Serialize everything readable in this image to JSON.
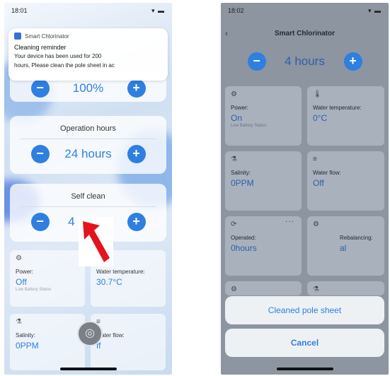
{
  "left_screen": {
    "status_time": "18:01",
    "status_icons": "▾ ▬",
    "notification": {
      "app_name": "Smart Chlorinator",
      "title": "Cleaning reminder",
      "body_line1": "Your device has been used for 200",
      "body_line2": "hours, Please clean the pole sheet in ac"
    },
    "stepper_top": {
      "minus": "−",
      "value": "100%",
      "plus": "+"
    },
    "operation_hours": {
      "title": "Operation hours",
      "minus": "−",
      "value": "24 hours",
      "plus": "+"
    },
    "self_clean": {
      "title": "Self clean",
      "minus": "−",
      "value": "4 hours",
      "plus": "+"
    },
    "tiles": [
      {
        "icon": "⚙",
        "label": "Power:",
        "value": "Off",
        "sub": "Low Battery Status"
      },
      {
        "icon": "🌡",
        "label": "Water temperature:",
        "value": "30.7°C",
        "sub": ""
      },
      {
        "icon": "⚗",
        "label": "Salinity:",
        "value": "0PPM",
        "sub": ""
      },
      {
        "icon": "≡",
        "label": "Water flow:",
        "value": "ff",
        "sub": ""
      }
    ],
    "fab_icon": "◎"
  },
  "right_screen": {
    "status_time": "18:02",
    "status_icons": "▾ ▬",
    "nav": {
      "back": "‹",
      "title": "Smart Chlorinator"
    },
    "stepper": {
      "minus": "−",
      "value": "4 hours",
      "plus": "+"
    },
    "tiles": [
      {
        "icon": "⚙",
        "label": "Power:",
        "value": "On",
        "sub": "Low Battery Status"
      },
      {
        "icon": "🌡",
        "label": "Water temperature:",
        "value": "0°C",
        "sub": ""
      },
      {
        "icon": "⚗",
        "label": "Salinity:",
        "value": "0PPM",
        "sub": ""
      },
      {
        "icon": "≡",
        "label": "Water flow:",
        "value": "Off",
        "sub": ""
      },
      {
        "icon": "⟳",
        "label": "Operated:",
        "value": "0hours",
        "sub": ""
      },
      {
        "icon": "⚙",
        "label": "Rebalancing:",
        "value": "al",
        "sub": ""
      }
    ],
    "more_dots": "···",
    "action_sheet": {
      "option": "Cleaned pole sheet",
      "cancel": "Cancel"
    },
    "pointer_color": "#e3141c"
  },
  "colors": {
    "accent": "#2f7fe0",
    "pointer": "#e3141c"
  }
}
